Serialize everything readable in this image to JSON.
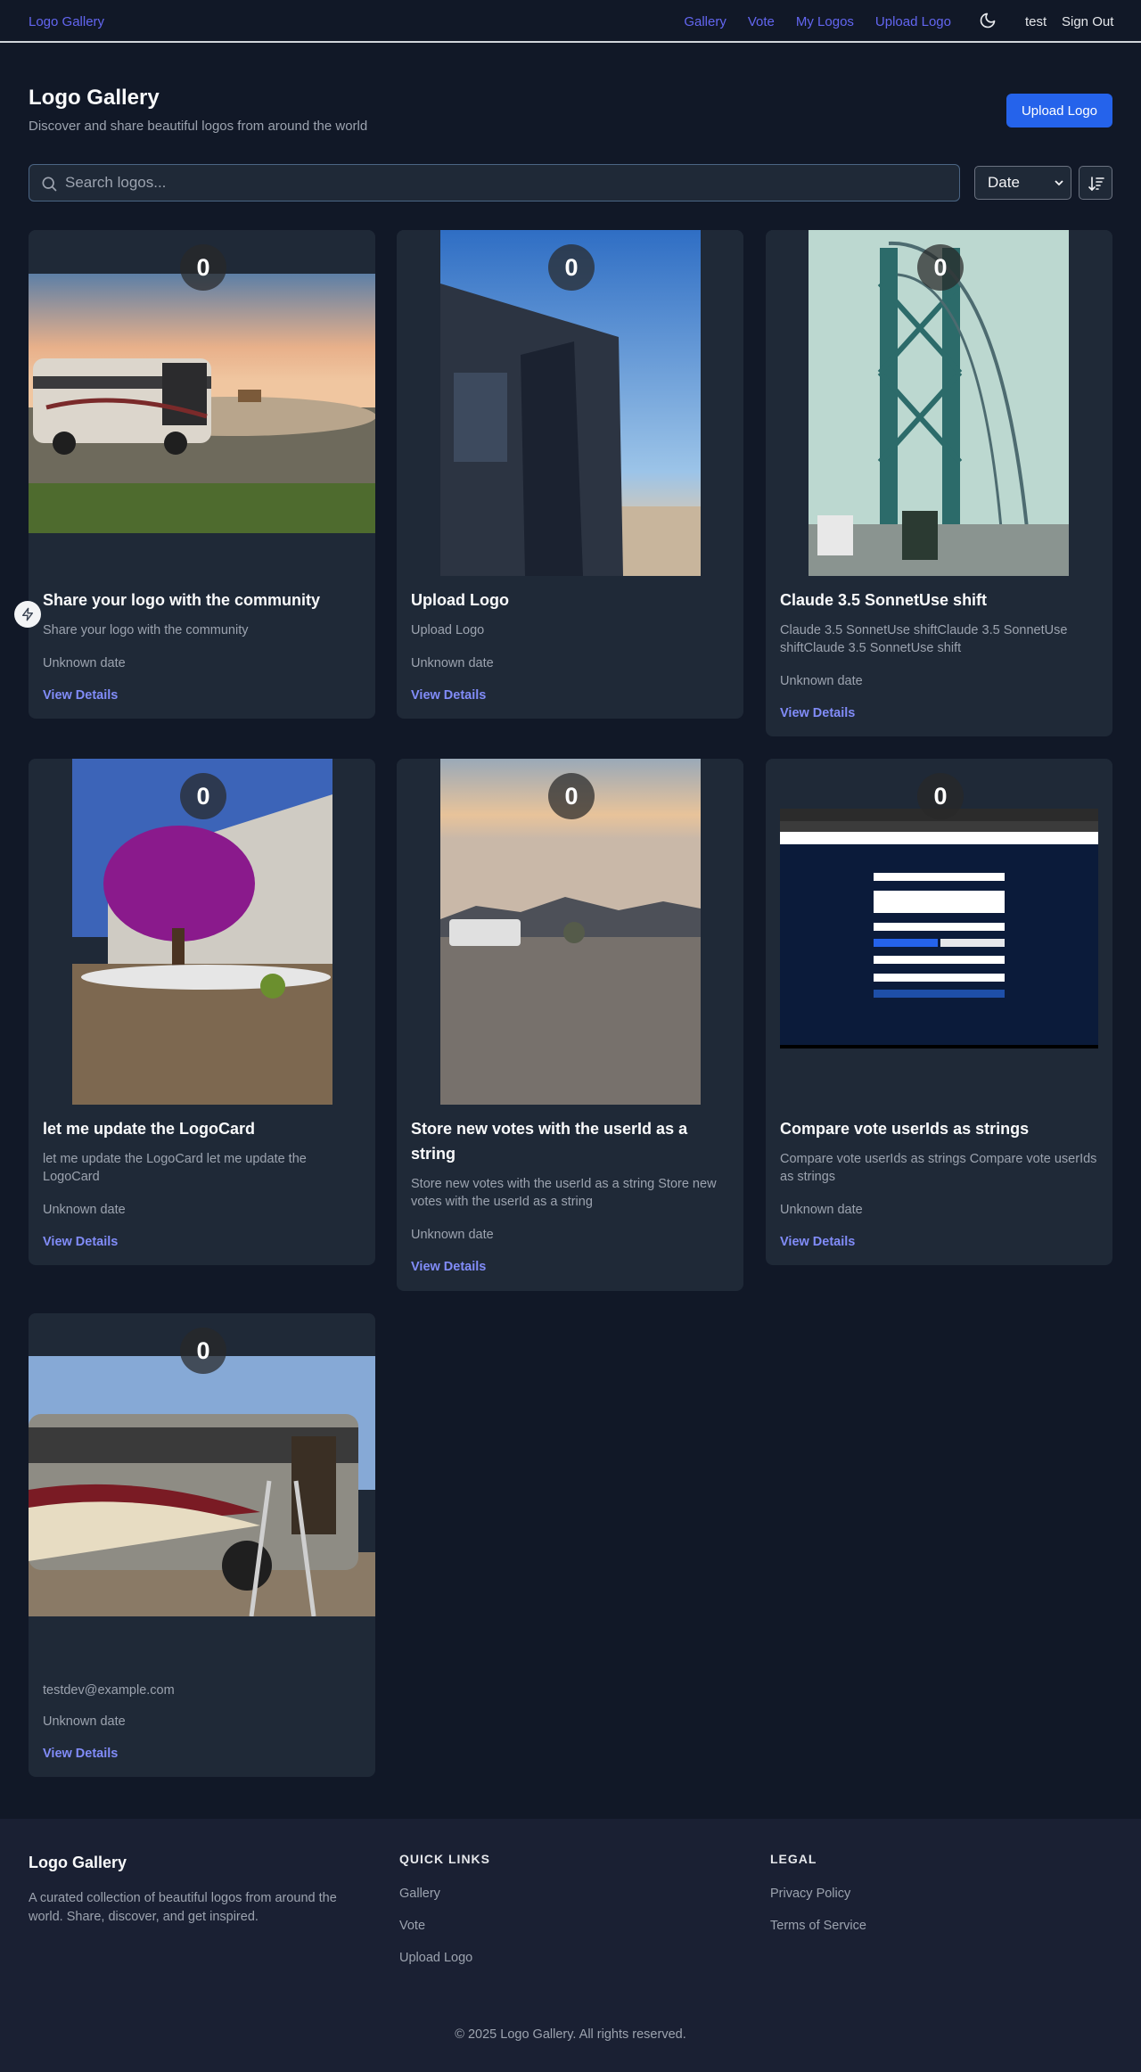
{
  "nav": {
    "brand": "Logo Gallery",
    "links": [
      "Gallery",
      "Vote",
      "My Logos",
      "Upload Logo"
    ],
    "user": "test",
    "sign_out": "Sign Out",
    "theme_icon": "moon-icon"
  },
  "header": {
    "title": "Logo Gallery",
    "subtitle": "Discover and share beautiful logos from around the world",
    "upload_button": "Upload Logo"
  },
  "search": {
    "placeholder": "Search logos...",
    "value": ""
  },
  "sort": {
    "selected": "Date",
    "direction_icon": "sort-descending-icon"
  },
  "cards": [
    {
      "votes": "0",
      "title": "Share your logo with the community",
      "description": "Share your logo with the community",
      "date": "Unknown date",
      "link": "View Details"
    },
    {
      "votes": "0",
      "title": "Upload Logo",
      "description": "Upload Logo",
      "date": "Unknown date",
      "link": "View Details"
    },
    {
      "votes": "0",
      "title": "Claude 3.5 SonnetUse shift",
      "description": "Claude 3.5 SonnetUse shiftClaude 3.5 SonnetUse shiftClaude 3.5 SonnetUse shift",
      "date": "Unknown date",
      "link": "View Details"
    },
    {
      "votes": "0",
      "title": "let me update the LogoCard",
      "description": "let me update the LogoCard let me update the LogoCard",
      "date": "Unknown date",
      "link": "View Details"
    },
    {
      "votes": "0",
      "title": "Store new votes with the userId as a string",
      "description": "Store new votes with the userId as a string Store new votes with the userId as a string",
      "date": "Unknown date",
      "link": "View Details"
    },
    {
      "votes": "0",
      "title": "Compare vote userIds as strings",
      "description": "Compare vote userIds as strings Compare vote userIds as strings",
      "date": "Unknown date",
      "link": "View Details"
    },
    {
      "votes": "0",
      "title": "",
      "description": "testdev@example.com",
      "date": "Unknown date",
      "link": "View Details"
    }
  ],
  "footer": {
    "brand": "Logo Gallery",
    "description": "A curated collection of beautiful logos from around the world. Share, discover, and get inspired.",
    "quick_links_heading": "QUICK LINKS",
    "quick_links": [
      "Gallery",
      "Vote",
      "Upload Logo"
    ],
    "legal_heading": "LEGAL",
    "legal_links": [
      "Privacy Policy",
      "Terms of Service"
    ],
    "copyright": "© 2025 Logo Gallery. All rights reserved."
  },
  "colors": {
    "background": "#111827",
    "card": "#1f2937",
    "accent": "#6366f1",
    "primary_button": "#2563eb",
    "link": "#818cf8"
  }
}
